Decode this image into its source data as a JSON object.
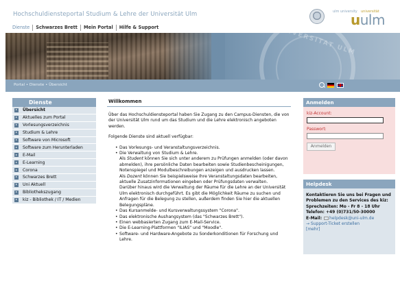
{
  "header": {
    "site_title": "Hochschuldiensteportal Studium & Lehre der Universität Ulm",
    "nav": [
      "Dienste",
      "Schwarzes Brett",
      "Mein Portal",
      "Hilfe & Support"
    ],
    "logo_small_left": "ulm university",
    "logo_small_right": "universität",
    "logo_word_u": "u",
    "logo_word_rest": "ulm"
  },
  "banner": {
    "seal_text": "UNIVERSITAT ULM"
  },
  "breadcrumb": "Portal • Dienste • Übersicht",
  "leftnav": {
    "title": "Dienste",
    "items": [
      "Übersicht",
      "Aktuelles zum Portal",
      "Vorlesungsverzeichnis",
      "Studium & Lehre",
      "Software von Microsoft",
      "Software zum Herunterladen",
      "E-Mail",
      "E-Learning",
      "Corona",
      "Schwarzes Brett",
      "Uni Aktuell",
      "Bibliothekszugang",
      "kiz - Bibliothek / IT / Medien"
    ]
  },
  "main": {
    "title": "Willkommen",
    "intro": "Über das Hochschuldiensteportal haben Sie Zugang zu den Campus-Diensten, die von der Universität Ulm rund um das Studium und die Lehre elektronisch angeboten werden.",
    "lead": "Folgende Dienste sind aktuell verfügbar:",
    "item1": "Das Vorlesungs- und Veranstaltungsverzeichnis.",
    "item2": "Die Verwaltung von Studium & Lehre.",
    "item2_s1_pre": "Als ",
    "item2_s1_em": "Student",
    "item2_s1_post": " können Sie sich unter anderem zu Prüfungen anmelden (oder davon abmelden), ihre persönliche Daten bearbeiten sowie Studienbescheinigungen, Notenspiegel und Modulbeschreibungen anzeigen und ausdrucken lassen.",
    "item2_s2_pre": "Als ",
    "item2_s2_em": "Dozent",
    "item2_s2_post": " können Sie beispielsweise Ihre Veranstaltungsdaten bearbeiten, aktuelle Zusatzinformationen eingeben oder Prüfungsdaten verwalten.",
    "item2_s3": "Darüber hinaus wird die Verwaltung der Räume für die Lehre an der Universität Ulm elektronisch durchgeführt. Es gibt die Möglichkeit Räume zu suchen und Anfragen für die Belegung zu stellen, außerdem finden Sie hier die aktuellen Belegungspläne.",
    "item3": "Das Kursanmelde- und Kursverwaltungssystem \"Corona\".",
    "item4": "Das elektronische Aushangsystem (das \"Schwarzes Brett\").",
    "item5": "Einen webbasierten Zugang zum E-Mail-Service.",
    "item6": "Die E-Learning-Plattformen \"ILIAS\" und \"Moodle\".",
    "item7": "Software- und Hardware-Angebote zu Sonderkonditionen für Forschung und Lehre."
  },
  "login": {
    "title": "Anmelden",
    "account_label": "kiz-Account:",
    "account_value": "",
    "password_label": "Passwort:",
    "password_value": "",
    "button": "Anmelden"
  },
  "helpdesk": {
    "title": "Helpdesk",
    "line1": "Kontaktieren Sie uns bei Fragen und Problemen zu den Services des kiz:",
    "hours": "Sprechzeiten: Mo - Fr 8 - 18 Uhr",
    "phone": "Telefon: +49 (0)731/50-30000",
    "email_label": "E-Mail:",
    "email": "helpdesk@uni-ulm.de",
    "ticket": "→ Support-Ticket erstellen",
    "more": "[mehr]"
  }
}
